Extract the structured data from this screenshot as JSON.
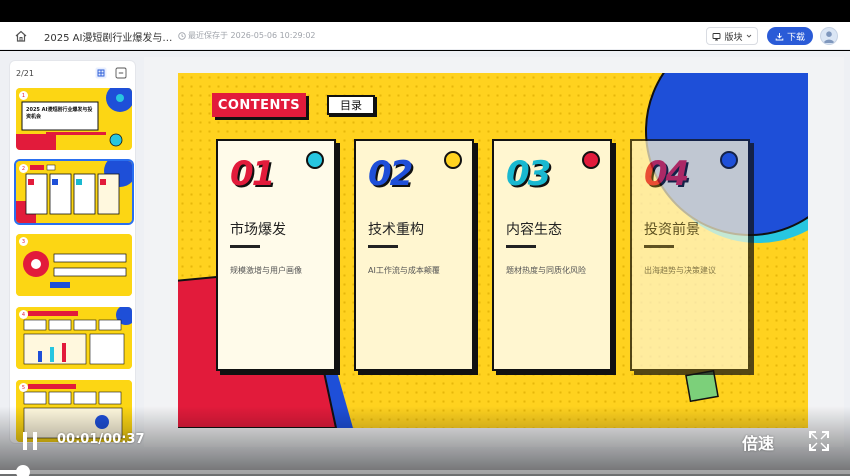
{
  "app_bar": {
    "doc_title": "2025 AI漫短剧行业爆发与…",
    "saved_status": "最近保存于 2026-05-06 10:29:02",
    "theme_label": "版块",
    "download_label": "下载"
  },
  "sidebar": {
    "page_counter": "2/21",
    "thumbnails": [
      {
        "number": "1",
        "title": "2025 AI漫短剧行业爆发与投资机会"
      },
      {
        "number": "2",
        "active": true
      },
      {
        "number": "3"
      },
      {
        "number": "4"
      },
      {
        "number": "5"
      }
    ]
  },
  "slide": {
    "contents_label": "CONTENTS",
    "catalog_label": "目录",
    "cards": [
      {
        "number": "01",
        "title": "市场爆发",
        "subtitle": "规模激增与用户画像",
        "number_color": "#e21b3b",
        "dot_color": "#27c6e0"
      },
      {
        "number": "02",
        "title": "技术重构",
        "subtitle": "AI工作流与成本颠覆",
        "number_color": "#1e4fd8",
        "dot_color": "#ffd21f"
      },
      {
        "number": "03",
        "title": "内容生态",
        "subtitle": "题材热度与同质化风险",
        "number_color": "#19b8d0",
        "dot_color": "#e21b3b"
      },
      {
        "number": "04",
        "title": "投资前景",
        "subtitle": "出海趋势与决策建议",
        "number_color": "#e21b3b",
        "dot_color": "#1e4fd8"
      }
    ],
    "colors": {
      "yellow": "#ffd21f",
      "red": "#e21b3b",
      "blue": "#1e4fd8",
      "cyan": "#27c6e0",
      "green": "#7cd07a"
    }
  },
  "player": {
    "time": "00:01/00:37",
    "speed_label": "倍速",
    "progress": 0.027
  },
  "icons": [
    "home-icon",
    "clock-icon",
    "theme-icon",
    "chevron-down-icon",
    "download-icon",
    "grid-view-icon",
    "collapse-icon",
    "pause-icon",
    "fullscreen-icon"
  ]
}
